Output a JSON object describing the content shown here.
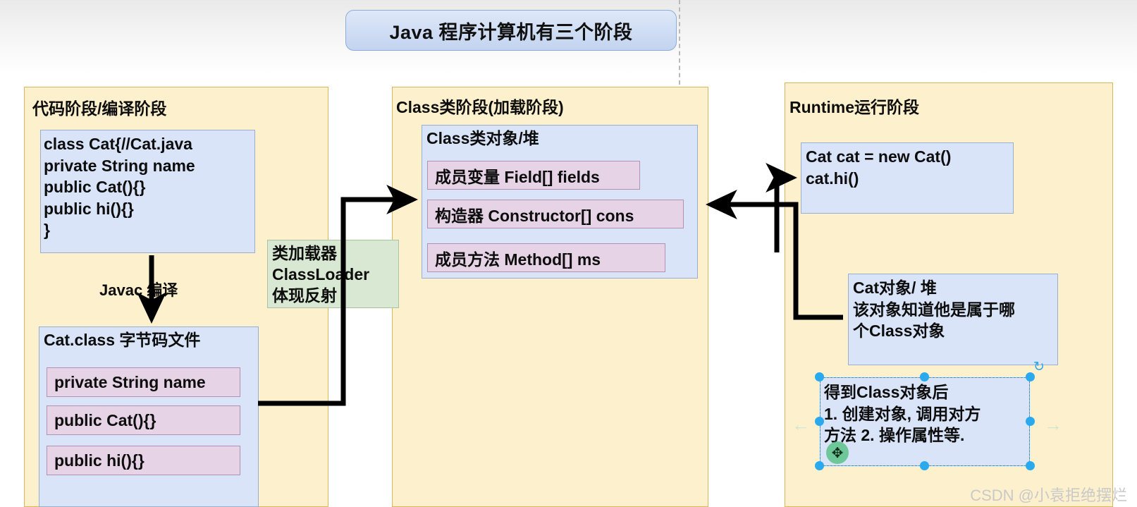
{
  "title": {
    "text": "Java 程序计算机有三个阶段"
  },
  "panels": {
    "compile": {
      "title": "代码阶段/编译阶段",
      "source_code": "class Cat{//Cat.java\nprivate String name\npublic Cat(){}\npublic hi(){}\n}",
      "compile_label": "Javac 编译",
      "bytecode_title": "Cat.class 字节码文件",
      "bytecode_members": [
        "private String name",
        "public Cat(){}",
        "public hi(){}"
      ]
    },
    "classstage": {
      "title": "Class类阶段(加载阶段)",
      "class_object_title": "Class类对象/堆",
      "class_members": [
        "成员变量 Field[] fields",
        "构造器 Constructor[] cons",
        "成员方法 Method[] ms"
      ]
    },
    "runtime": {
      "title": "Runtime运行阶段",
      "runtime_code": "Cat cat = new Cat()\ncat.hi()",
      "cat_object_note": "Cat对象/ 堆\n该对象知道他是属于哪\n个Class对象",
      "selected_note": "得到Class对象后\n1. 创建对象, 调用对方\n方法 2. 操作属性等."
    }
  },
  "notes": {
    "classloader": "类加载器\nClassLoader\n体现反射"
  },
  "icons": {
    "rotate": "↻",
    "move": "✥",
    "arrow_left": "←",
    "arrow_right": "→"
  },
  "watermark": {
    "text": "CSDN @小袁拒绝摆烂"
  },
  "colors": {
    "panel_bg": "#fdf0cd",
    "panel_border": "#d8b75c",
    "blue_box": "#d9e4f8",
    "blue_border": "#9aafd0",
    "pink_box": "#e6d4e6",
    "pink_border": "#b391b5",
    "green_box": "#d9e8d2",
    "green_border": "#a9c39c",
    "title_pill": "#cfddf4",
    "selection": "#2aa9ef",
    "watermark": "#c9c9c9"
  }
}
